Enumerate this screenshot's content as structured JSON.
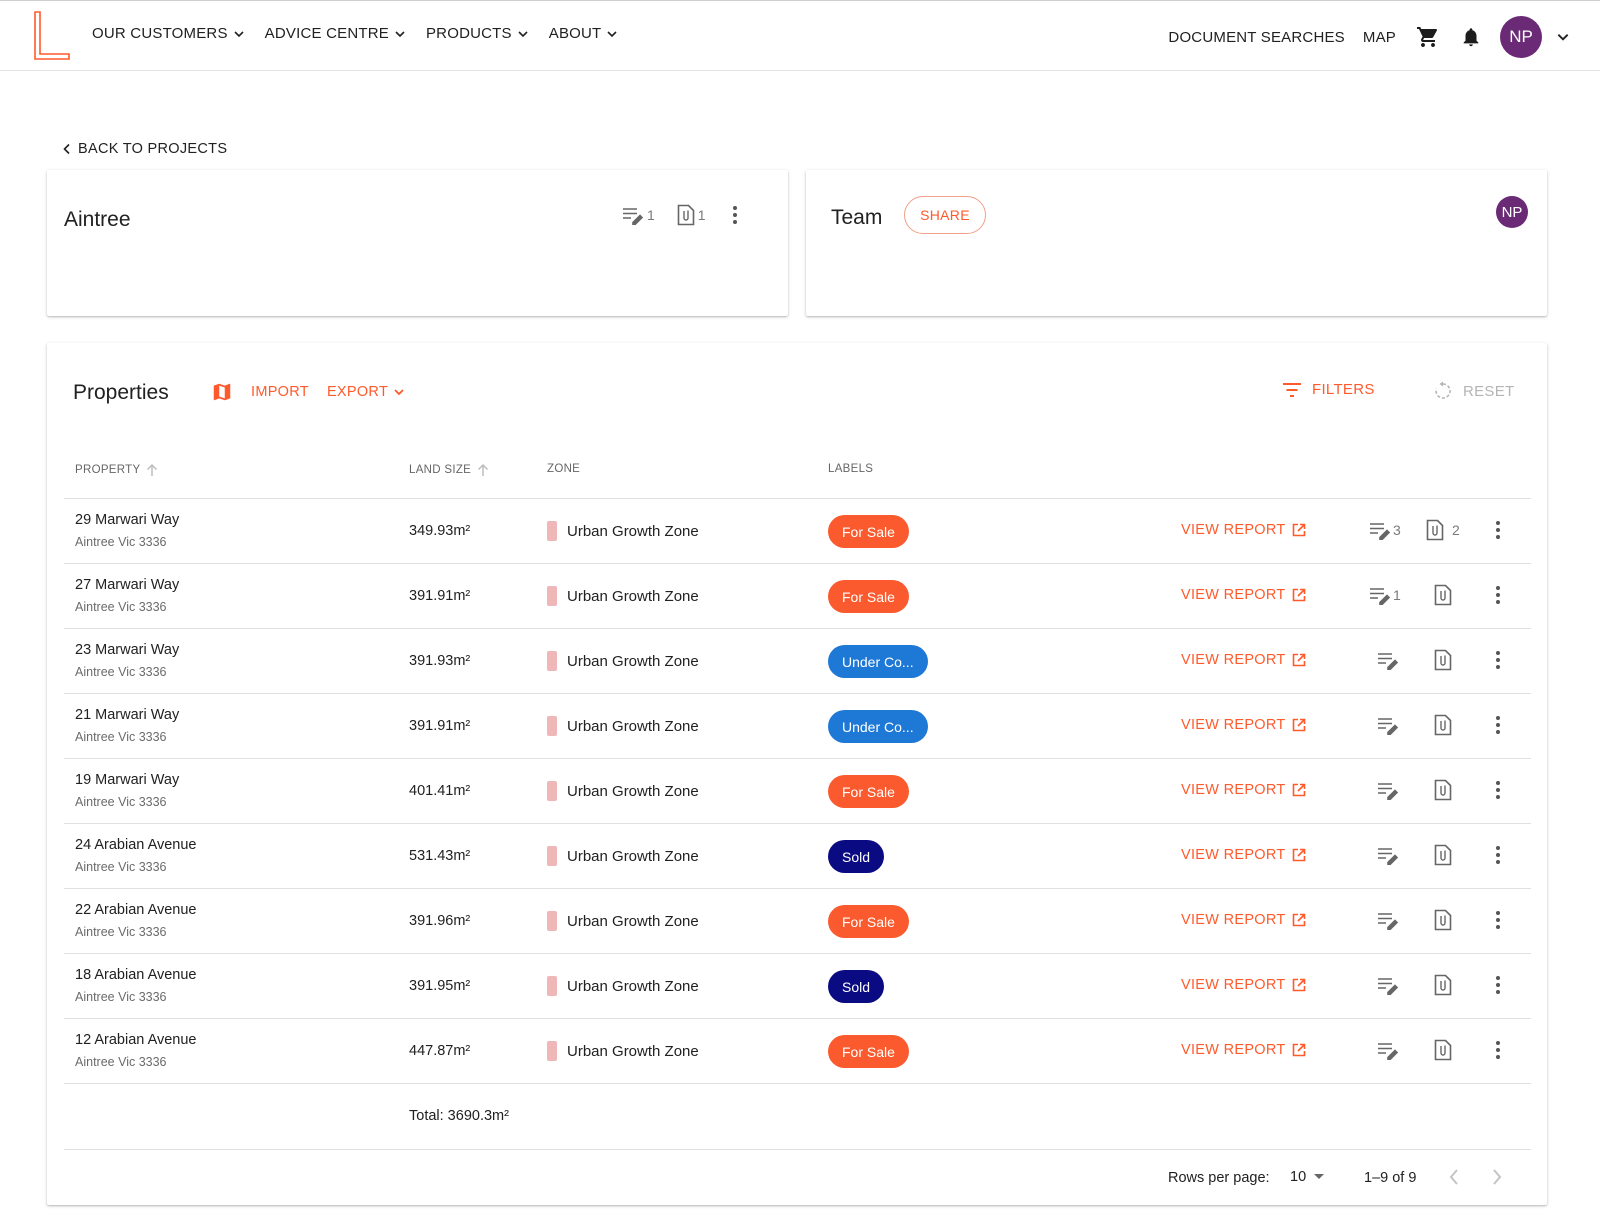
{
  "colors": {
    "brand": "#ff5a2c",
    "avatar": "#6b2a75",
    "for_sale": "#fa5a2d",
    "under_contract": "#1e78d6",
    "sold": "#0a0a82",
    "zone_swatch": "#f0b7b9",
    "icon_grey": "#757575"
  },
  "nav": {
    "menu": [
      {
        "label": "OUR CUSTOMERS"
      },
      {
        "label": "ADVICE CENTRE"
      },
      {
        "label": "PRODUCTS"
      },
      {
        "label": "ABOUT"
      }
    ],
    "document_searches": "DOCUMENT SEARCHES",
    "map": "MAP",
    "avatar_initials": "NP",
    "icons": [
      "cart-icon",
      "bell-icon",
      "chevron-down-icon"
    ]
  },
  "back_link": "BACK TO PROJECTS",
  "project": {
    "name": "Aintree",
    "notes_count": "1",
    "docs_count": "1"
  },
  "team": {
    "title": "Team",
    "share_label": "SHARE",
    "member_initials": "NP"
  },
  "properties": {
    "title": "Properties",
    "import_label": "IMPORT",
    "export_label": "EXPORT",
    "filters_label": "FILTERS",
    "reset_label": "RESET",
    "columns": {
      "property": "PROPERTY",
      "land_size": "LAND SIZE",
      "zone": "ZONE",
      "labels": "LABELS"
    },
    "view_report_label": "VIEW REPORT",
    "rows": [
      {
        "address": "29 Marwari Way",
        "suburb": "Aintree Vic 3336",
        "land_size": "349.93m²",
        "zone": "Urban Growth Zone",
        "label": "For Sale",
        "label_type": "for_sale",
        "notes": "3",
        "docs": "2"
      },
      {
        "address": "27 Marwari Way",
        "suburb": "Aintree Vic 3336",
        "land_size": "391.91m²",
        "zone": "Urban Growth Zone",
        "label": "For Sale",
        "label_type": "for_sale",
        "notes": "1",
        "docs": ""
      },
      {
        "address": "23 Marwari Way",
        "suburb": "Aintree Vic 3336",
        "land_size": "391.93m²",
        "zone": "Urban Growth Zone",
        "label": "Under Co...",
        "label_type": "under_contract",
        "notes": "",
        "docs": ""
      },
      {
        "address": "21 Marwari Way",
        "suburb": "Aintree Vic 3336",
        "land_size": "391.91m²",
        "zone": "Urban Growth Zone",
        "label": "Under Co...",
        "label_type": "under_contract",
        "notes": "",
        "docs": ""
      },
      {
        "address": "19 Marwari Way",
        "suburb": "Aintree Vic 3336",
        "land_size": "401.41m²",
        "zone": "Urban Growth Zone",
        "label": "For Sale",
        "label_type": "for_sale",
        "notes": "",
        "docs": ""
      },
      {
        "address": "24 Arabian Avenue",
        "suburb": "Aintree Vic 3336",
        "land_size": "531.43m²",
        "zone": "Urban Growth Zone",
        "label": "Sold",
        "label_type": "sold",
        "notes": "",
        "docs": ""
      },
      {
        "address": "22 Arabian Avenue",
        "suburb": "Aintree Vic 3336",
        "land_size": "391.96m²",
        "zone": "Urban Growth Zone",
        "label": "For Sale",
        "label_type": "for_sale",
        "notes": "",
        "docs": ""
      },
      {
        "address": "18 Arabian Avenue",
        "suburb": "Aintree Vic 3336",
        "land_size": "391.95m²",
        "zone": "Urban Growth Zone",
        "label": "Sold",
        "label_type": "sold",
        "notes": "",
        "docs": ""
      },
      {
        "address": "12 Arabian Avenue",
        "suburb": "Aintree Vic 3336",
        "land_size": "447.87m²",
        "zone": "Urban Growth Zone",
        "label": "For Sale",
        "label_type": "for_sale",
        "notes": "",
        "docs": ""
      }
    ],
    "total": "Total: 3690.3m²",
    "pagination": {
      "rows_per_page_label": "Rows per page:",
      "rows_per_page": "10",
      "range": "1–9 of 9"
    }
  }
}
